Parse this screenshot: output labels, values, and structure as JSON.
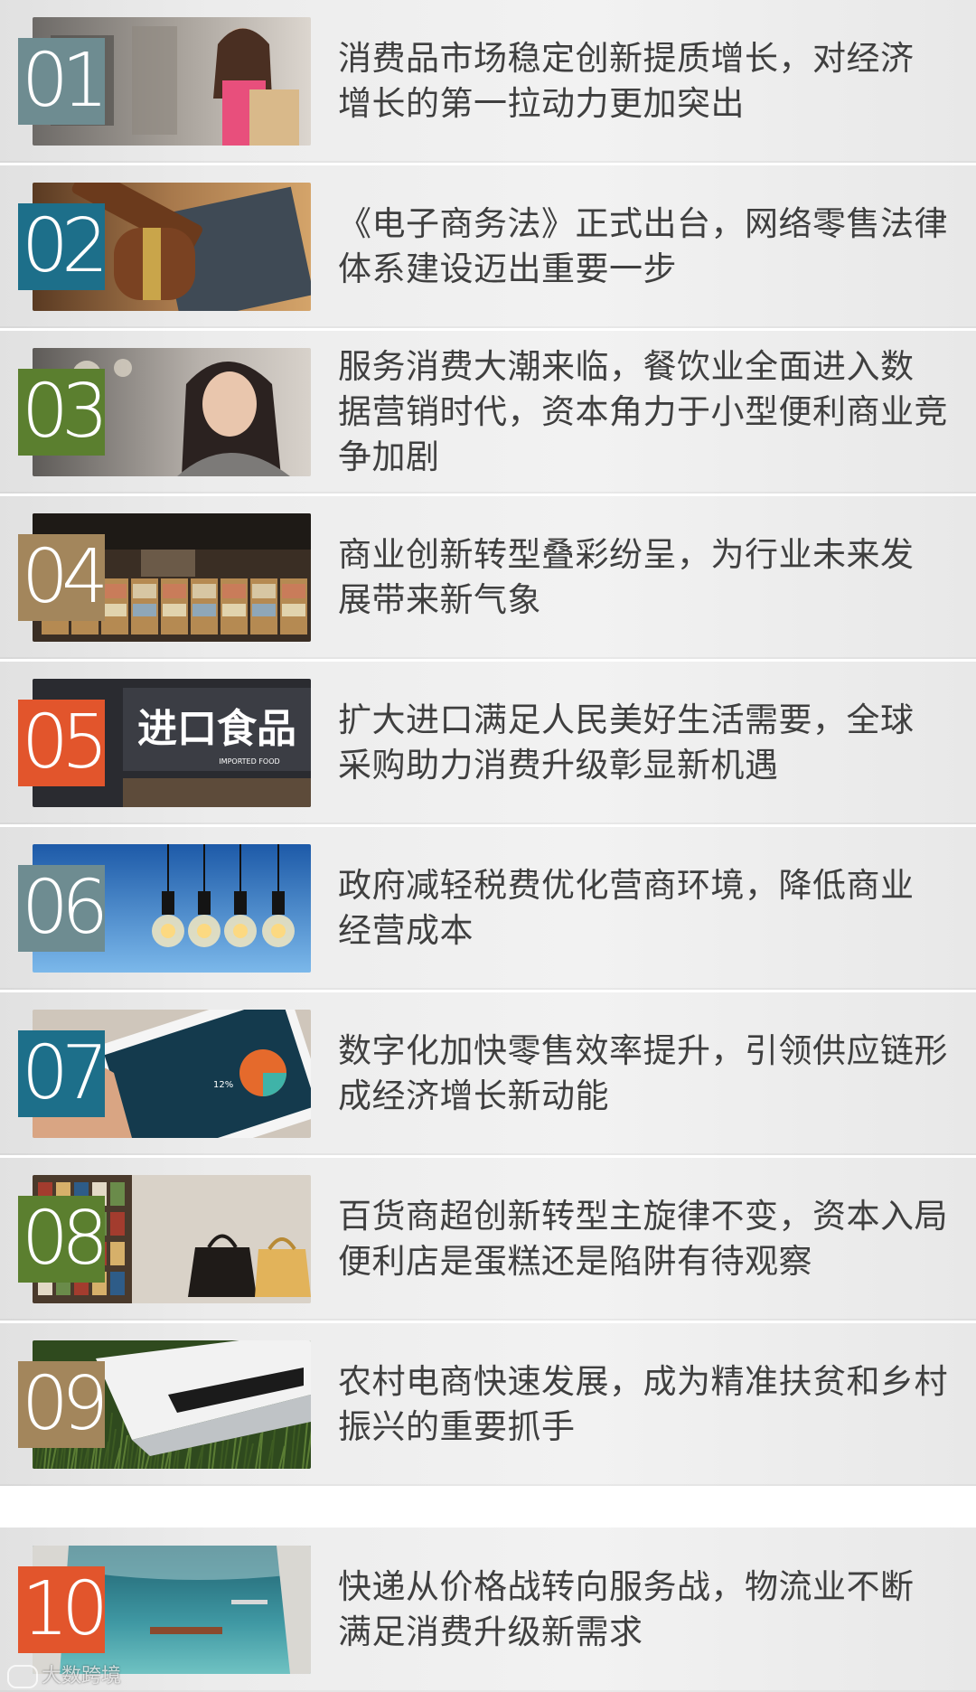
{
  "items": [
    {
      "number": "01",
      "badge_color": "#6e8c91",
      "text_lines": [
        "消费品市场稳定创新提质增长，对经济",
        "增长的第一拉动力更加突出"
      ],
      "image": "shopping-woman-photo"
    },
    {
      "number": "02",
      "badge_color": "#1d6f8a",
      "text_lines": [
        "《电子商务法》正式出台，网络零售法律",
        "体系建设迈出重要一步"
      ],
      "image": "gavel-photo"
    },
    {
      "number": "03",
      "badge_color": "#5b7f2f",
      "text_lines": [
        "服务消费大潮来临，餐饮业全面进入数",
        "据营销时代，资本角力于小型便利商业竞",
        "争加剧"
      ],
      "image": "smiling-woman-cafe-photo"
    },
    {
      "number": "04",
      "badge_color": "#a3865c",
      "text_lines": [
        "商业创新转型叠彩纷呈，为行业未来发",
        "展带来新气象"
      ],
      "image": "bookstore-interior-photo"
    },
    {
      "number": "05",
      "badge_color": "#e2552c",
      "text_lines": [
        "扩大进口满足人民美好生活需要，全球",
        "采购助力消费升级彰显新机遇"
      ],
      "image": "imported-food-store-photo",
      "sign_text": "进口食品",
      "sign_sub": "IMPORTED FOOD"
    },
    {
      "number": "06",
      "badge_color": "#6e8c91",
      "text_lines": [
        "政府减轻税费优化营商环境，降低商业",
        "经营成本"
      ],
      "image": "light-bulbs-photo"
    },
    {
      "number": "07",
      "badge_color": "#1d6f8a",
      "text_lines": [
        "数字化加快零售效率提升，引领供应链形",
        "成经济增长新动能"
      ],
      "image": "tablet-chart-photo",
      "tablet_label": "12%"
    },
    {
      "number": "08",
      "badge_color": "#5b7f2f",
      "text_lines": [
        "百货商超创新转型主旋律不变，资本入局",
        "便利店是蛋糕还是陷阱有待观察"
      ],
      "image": "handbags-shelf-photo"
    },
    {
      "number": "09",
      "badge_color": "#a3865c",
      "text_lines": [
        "农村电商快速发展，成为精准扶贫和乡村",
        "振兴的重要抓手"
      ],
      "image": "laptop-on-grass-photo"
    },
    {
      "number": "10",
      "badge_color": "#e2552c",
      "text_lines": [
        "快递从价格战转向服务战，物流业不断",
        "满足消费升级新需求"
      ],
      "image": "aerial-port-photo"
    }
  ],
  "watermark": {
    "text": "大数跨境",
    "logo": "cloud-logo-icon"
  }
}
